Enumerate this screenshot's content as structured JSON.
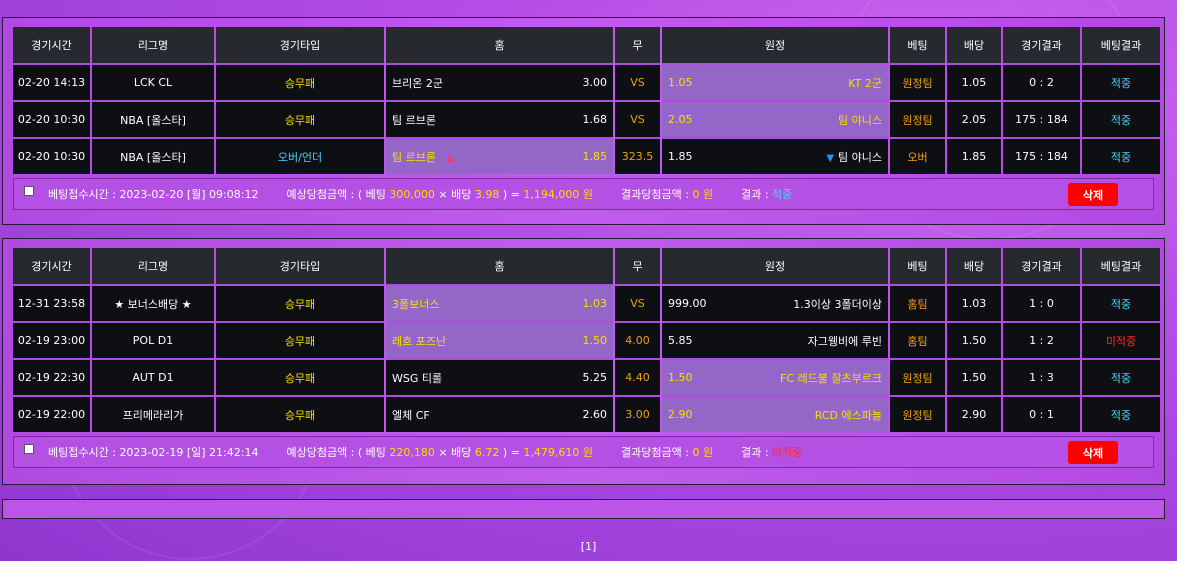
{
  "headers": [
    "경기시간",
    "리그명",
    "경기타입",
    "홈",
    "무",
    "원정",
    "베팅",
    "배당",
    "경기결과",
    "베팅결과"
  ],
  "bets": [
    {
      "rows": [
        {
          "time": "02-20 14:13",
          "league": "LCK CL",
          "type": "승무패",
          "home": "브리온 2군",
          "home_odds": "3.00",
          "draw": "VS",
          "away_odds": "1.05",
          "away": "KT 2군",
          "pick": "원정팀",
          "odds": "1.05",
          "score": "0 : 2",
          "result": "적중",
          "selected": "away"
        },
        {
          "time": "02-20 10:30",
          "league": "NBA [올스타]",
          "type": "승무패",
          "home": "팀 르브론",
          "home_odds": "1.68",
          "draw": "VS",
          "away_odds": "2.05",
          "away": "팀 야니스",
          "pick": "원정팀",
          "odds": "2.05",
          "score": "175 : 184",
          "result": "적중",
          "selected": "away"
        },
        {
          "time": "02-20 10:30",
          "league": "NBA [올스타]",
          "type": "오버/언더",
          "home": "팀 르브론",
          "home_odds": "1.85",
          "draw": "323.5",
          "away_odds": "1.85",
          "away": "팀 야니스",
          "pick": "오버",
          "odds": "1.85",
          "score": "175 : 184",
          "result": "적중",
          "selected": "home",
          "arrows": true
        }
      ],
      "summary": {
        "time_label": "베팅접수시간 :",
        "time_value": "2023-02-20 [월] 09:08:12",
        "expected_label": "예상당첨금액 : ( 베팅",
        "bet_amount": "300,000",
        "mult": "× 배당",
        "total_odds": "3.98",
        "eq": ") =",
        "expected_value": "1,194,000 원",
        "won_label": "결과당첨금액 :",
        "won_value": "0 원",
        "result_label": "결과 :",
        "result_value": "적중",
        "delete_label": "삭제"
      }
    },
    {
      "rows": [
        {
          "time": "12-31 23:58",
          "league": "★ 보너스배당 ★",
          "type": "승무패",
          "home": "3폴보너스",
          "home_odds": "1.03",
          "draw": "VS",
          "away_odds": "999.00",
          "away": "1.3이상 3폴더이상",
          "pick": "홈팀",
          "odds": "1.03",
          "score": "1 : 0",
          "result": "적중",
          "selected": "home"
        },
        {
          "time": "02-19 23:00",
          "league": "POL D1",
          "type": "승무패",
          "home": "레흐 포즈난",
          "home_odds": "1.50",
          "draw": "4.00",
          "away_odds": "5.85",
          "away": "자그웽비에 루빈",
          "pick": "홈팀",
          "odds": "1.50",
          "score": "1 : 2",
          "result": "미적중",
          "selected": "home"
        },
        {
          "time": "02-19 22:30",
          "league": "AUT D1",
          "type": "승무패",
          "home": "WSG 티롤",
          "home_odds": "5.25",
          "draw": "4.40",
          "away_odds": "1.50",
          "away": "FC 레드불 잘츠부르크",
          "pick": "원정팀",
          "odds": "1.50",
          "score": "1 : 3",
          "result": "적중",
          "selected": "away"
        },
        {
          "time": "02-19 22:00",
          "league": "프리메라리가",
          "type": "승무패",
          "home": "엘체 CF",
          "home_odds": "2.60",
          "draw": "3.00",
          "away_odds": "2.90",
          "away": "RCD 에스파뇰",
          "pick": "원정팀",
          "odds": "2.90",
          "score": "0 : 1",
          "result": "적중",
          "selected": "away"
        }
      ],
      "summary": {
        "time_label": "베팅접수시간 :",
        "time_value": "2023-02-19 [일] 21:42:14",
        "expected_label": "예상당첨금액 : ( 베팅",
        "bet_amount": "220,180",
        "mult": "× 배당",
        "total_odds": "6.72",
        "eq": ") =",
        "expected_value": "1,479,610 원",
        "won_label": "결과당첨금액 :",
        "won_value": "0 원",
        "result_label": "결과 :",
        "result_value": "미적중",
        "delete_label": "삭제"
      }
    }
  ],
  "pagination": "[1]",
  "colors": {
    "accent_yellow": "#f5e100",
    "hit": "#4fd2f5",
    "miss": "#ff2a2a",
    "draw": "#f0a20e",
    "selected_bg": "#9466c8"
  }
}
